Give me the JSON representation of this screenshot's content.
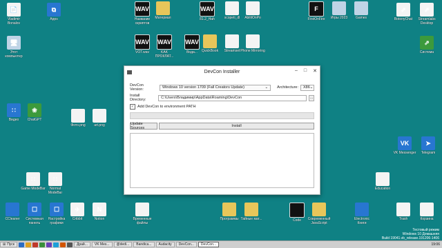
{
  "desktop": {
    "icons_top": [
      {
        "label": "Vladimir Bonalov",
        "glyph": "📄",
        "kind": "doc"
      },
      {
        "label": "Apps",
        "glyph": "⧉",
        "kind": "tile"
      },
      {
        "label": "Название скриптов",
        "glyph": "WAV",
        "kind": "wav"
      },
      {
        "label": "Материал",
        "glyph": "",
        "kind": "folder"
      },
      {
        "label": "81.2_Hah",
        "glyph": "WAV",
        "kind": "wav"
      },
      {
        "label": "scopeti_dl",
        "glyph": "",
        "kind": "doc"
      },
      {
        "label": "AbilitOnPo",
        "glyph": "",
        "kind": "doc"
      },
      {
        "label": "FirstOnFire",
        "glyph": "F",
        "kind": "wav"
      },
      {
        "label": "Игры 2023",
        "glyph": "",
        "kind": "pc"
      },
      {
        "label": "Games",
        "glyph": "",
        "kind": "pc"
      },
      {
        "label": "BotonyChat",
        "glyph": "⇗",
        "kind": "doc"
      },
      {
        "label": "Streamlabs Desktop",
        "glyph": "⇗",
        "kind": "doc"
      }
    ],
    "icons_row2": [
      {
        "label": "Этот компьютер",
        "glyph": "🖥",
        "kind": "pc"
      },
      {
        "label": "VOT.wav",
        "glyph": "WAV",
        "kind": "wav"
      },
      {
        "label": "KAK ПРОКЛАТ...",
        "glyph": "WAV",
        "kind": "wav"
      },
      {
        "label": "Вода...",
        "glyph": "WAV",
        "kind": "wav"
      },
      {
        "label": "QuickBook",
        "glyph": "",
        "kind": "folder"
      },
      {
        "label": "Streamset",
        "glyph": "",
        "kind": "doc"
      },
      {
        "label": "Phone Mirroring",
        "glyph": "",
        "kind": "doc"
      },
      {
        "label": "Система",
        "glyph": "⇗",
        "kind": "green"
      }
    ],
    "icons_mid": [
      {
        "label": "Видео",
        "glyph": "∷",
        "kind": "tile"
      },
      {
        "label": "ChatGPT",
        "glyph": "❀",
        "kind": "green"
      },
      {
        "label": "Фото.png",
        "glyph": "",
        "kind": "doc"
      },
      {
        "label": "art.png",
        "glyph": "",
        "kind": "doc"
      }
    ],
    "icons_right": [
      {
        "label": "VK Messenger",
        "glyph": "VK",
        "kind": "tile"
      },
      {
        "label": "Telegram",
        "glyph": "➤",
        "kind": "tile"
      },
      {
        "label": "Education",
        "glyph": "",
        "kind": "doc"
      }
    ],
    "icons_lower": [
      {
        "label": "Game ModeBar",
        "glyph": "∷",
        "kind": "doc"
      },
      {
        "label": "Normal ModeBar",
        "glyph": "∷",
        "kind": "doc"
      }
    ],
    "icons_bottom": [
      {
        "label": "CCleaner",
        "glyph": "",
        "kind": "tile"
      },
      {
        "label": "Системная панель",
        "glyph": "☐",
        "kind": "tile"
      },
      {
        "label": "Настройка графики",
        "glyph": "☐",
        "kind": "tile"
      },
      {
        "label": "Cribbit",
        "glyph": "✈",
        "kind": "doc"
      },
      {
        "label": "Notion",
        "glyph": "N",
        "kind": "doc"
      },
      {
        "label": "Временные файлы",
        "glyph": "",
        "kind": "doc"
      },
      {
        "label": "Программы",
        "glyph": "",
        "kind": "folder"
      },
      {
        "label": "Тайные мат...",
        "glyph": "",
        "kind": "folder"
      },
      {
        "label": "Code",
        "glyph": "",
        "kind": "wav"
      },
      {
        "label": "Современный JavaScript",
        "glyph": "",
        "kind": "folder"
      },
      {
        "label": "Electronic Книги",
        "glyph": "",
        "kind": "tile"
      },
      {
        "label": "Trash",
        "glyph": "",
        "kind": "doc"
      },
      {
        "label": "Корзина",
        "glyph": "",
        "kind": "doc"
      }
    ]
  },
  "window": {
    "title": "DevCon Installer",
    "min": "–",
    "max": "□",
    "close": "✕",
    "version_label": "DevCon Version:",
    "version_value": "Windows 10 version 1709 (Fall Creators Update)",
    "arch_label": "Architecture:",
    "arch_value": "X86",
    "dir_label": "Install Directory:",
    "dir_value": "C:\\Users\\Владимир\\AppData\\Roaming\\DevCon",
    "browse": "...",
    "add_path_label": "Add DevCon to environment PATH",
    "add_path_checked": "✓",
    "update_sources": "Update Sources",
    "install": "Install"
  },
  "taskbar": {
    "start": "Пуск",
    "items": [
      "Драй...",
      "VK Mes...",
      "@dedi...",
      "Bandica...",
      "Audacity",
      "DevCon...",
      "DevCon..."
    ],
    "clock": "19:06"
  },
  "watermark": {
    "line1": "Тестовый режим",
    "line2": "Windows 10 Домашняя",
    "line3": "Build 19041.vb_release.191206-1406"
  }
}
